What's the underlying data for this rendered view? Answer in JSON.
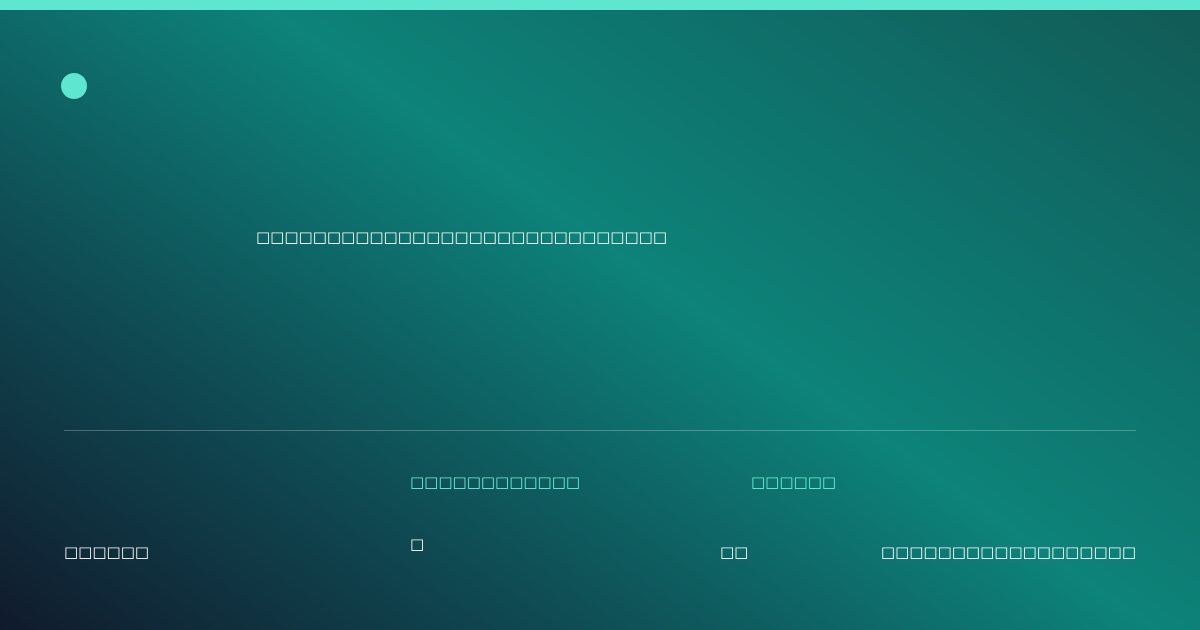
{
  "colors": {
    "accent": "#5ee6d0",
    "label_accent": "#6ff0d8",
    "text": "#ffffff"
  },
  "icons": {
    "brand": "circle-dot-icon"
  },
  "hero": {
    "subtitle": "□□□□□□□□□□□□□□□□□□□□□□□□□□□□□"
  },
  "footer": {
    "left_value": "□□□□□□",
    "col2_label": "□□□□□□□□□□□□",
    "col2_value": "□",
    "col3_label": "□□□□□□",
    "col3_value": "□□",
    "right_value": "□□□□□□□□□□□□□□□□□□"
  }
}
